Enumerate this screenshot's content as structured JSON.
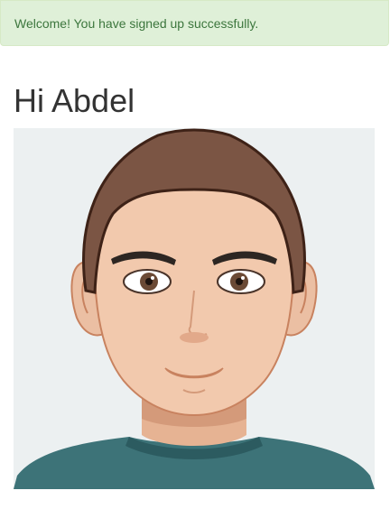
{
  "flash": {
    "message": "Welcome! You have signed up successfully.",
    "type": "success",
    "colors": {
      "background": "#dff0d8",
      "border": "#d6e9c6",
      "text": "#3c763d"
    }
  },
  "greeting": {
    "text": "Hi Abdel"
  },
  "avatar": {
    "icon": "cartoon-man-avatar-icon",
    "background_color": "#ecf0f1",
    "shirt_color": "#3d7378"
  }
}
